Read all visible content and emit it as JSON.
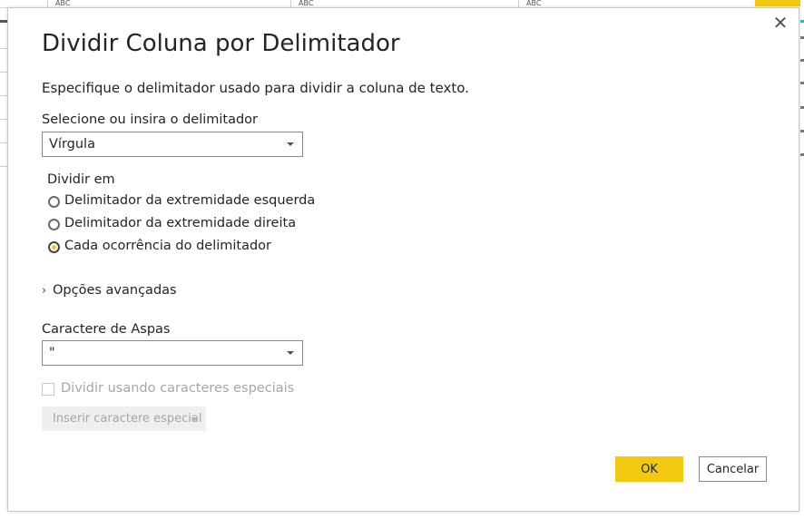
{
  "background": {
    "column_type_label": "ABC",
    "accent_color": "#f2c811"
  },
  "dialog": {
    "close_glyph": "✕",
    "title": "Dividir Coluna por Delimitador",
    "description": "Especifique o delimitador usado para dividir a coluna de texto.",
    "delimiter": {
      "label": "Selecione ou insira o delimitador",
      "selected_value": "Vírgula"
    },
    "split_at": {
      "label": "Dividir em",
      "options": [
        {
          "label": "Delimitador da extremidade esquerda",
          "checked": false
        },
        {
          "label": "Delimitador da extremidade direita",
          "checked": false
        },
        {
          "label": "Cada ocorrência do delimitador",
          "checked": true
        }
      ]
    },
    "advanced_options": {
      "chevron_glyph": "›",
      "label": "Opções avançadas",
      "expanded": false
    },
    "quote_char": {
      "label": "Caractere de Aspas",
      "selected_value": "\""
    },
    "special_chars": {
      "checkbox_label": "Dividir usando caracteres especiais",
      "checked": false,
      "disabled": true,
      "insert_button_label": "Inserir caractere especial"
    },
    "buttons": {
      "ok": "OK",
      "cancel": "Cancelar"
    },
    "icons": {
      "close": "close-icon",
      "dropdown": "chevron-down-icon",
      "advanced": "chevron-right-icon"
    }
  }
}
